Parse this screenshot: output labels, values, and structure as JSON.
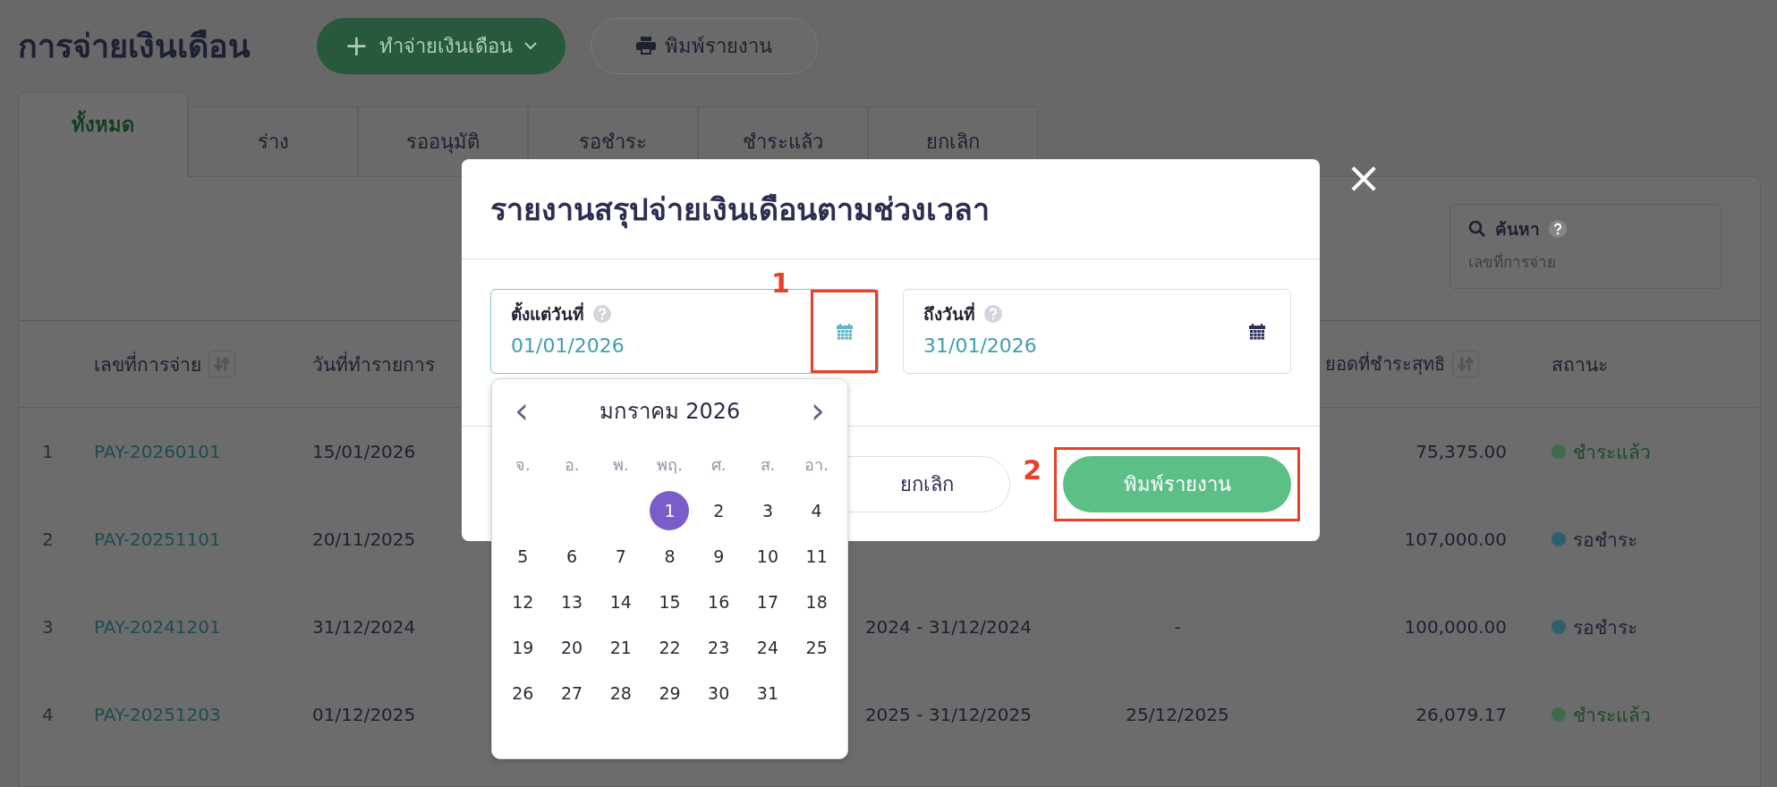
{
  "page": {
    "title": "การจ่ายเงินเดือน",
    "create_button": {
      "icon": "+",
      "label": "ทำจ่ายเงินเดือน"
    },
    "print_button": {
      "label": "พิมพ์รายงาน"
    }
  },
  "tabs": [
    {
      "label": "ทั้งหมด",
      "selected": true
    },
    {
      "label": "ร่าง",
      "selected": false
    },
    {
      "label": "รออนุมัติ",
      "selected": false
    },
    {
      "label": "รอชำระ",
      "selected": false
    },
    {
      "label": "ชำระแล้ว",
      "selected": false
    },
    {
      "label": "ยกเลิก",
      "selected": false
    }
  ],
  "search": {
    "label": "ค้นหา",
    "placeholder": "เลขที่การจ่าย"
  },
  "table": {
    "columns": [
      {
        "label": "เลขที่การจ่าย",
        "sortable": true
      },
      {
        "label": "วันที่ทำรายการ",
        "sortable": false
      },
      {
        "label": "ยอดที่ชำระสุทธิ",
        "sortable": true
      },
      {
        "label": "สถานะ",
        "sortable": false
      }
    ],
    "rows": [
      {
        "index": "1",
        "number": "PAY-20260101",
        "date": "15/01/2026",
        "amount": "75,375.00",
        "status": {
          "kind": "paid",
          "label": "ชำระแล้ว",
          "color": "#3e6b49"
        }
      },
      {
        "index": "2",
        "number": "PAY-20251101",
        "date": "20/11/2025",
        "amount": "107,000.00",
        "status": {
          "kind": "pending",
          "label": "รอชำระ",
          "color": "#2d606c"
        }
      },
      {
        "index": "3",
        "number": "PAY-20241201",
        "date": "31/12/2024",
        "period": "2024 - 31/12/2024",
        "paid_date": "-",
        "amount": "100,000.00",
        "status": {
          "kind": "pending",
          "label": "รอชำระ",
          "color": "#2d606c"
        }
      },
      {
        "index": "4",
        "number": "PAY-20251203",
        "date": "01/12/2025",
        "period": "2025 - 31/12/2025",
        "paid_date": "25/12/2025",
        "amount": "26,079.17",
        "status": {
          "kind": "paid",
          "label": "ชำระแล้ว",
          "color": "#3e6b49"
        }
      }
    ]
  },
  "modal": {
    "title": "รายงานสรุปจ่ายเงินเดือนตามช่วงเวลา",
    "close": "×",
    "fields": [
      {
        "label": "ตั้งแต่วันที่",
        "value": "01/01/2026",
        "focused": true,
        "highlight": "1"
      },
      {
        "label": "ถึงวันที่",
        "value": "31/01/2026",
        "focused": false
      }
    ],
    "cancel_button": "ยกเลิก",
    "print_button": {
      "label": "พิมพ์รายงาน",
      "highlight": "2"
    }
  },
  "calendar": {
    "month": "มกราคม 2026",
    "prev": "‹",
    "next": "›",
    "weekdays": [
      "จ.",
      "อ.",
      "พ.",
      "พฤ.",
      "ศ.",
      "ส.",
      "อา."
    ],
    "weeks": [
      [
        {
          "day": "1",
          "selected": true
        },
        {
          "day": "2",
          "selected": false
        },
        {
          "day": "3",
          "selected": false
        },
        {
          "day": "4",
          "selected": false
        }
      ],
      [
        {
          "day": "5",
          "selected": false
        },
        {
          "day": "6",
          "selected": false
        },
        {
          "day": "7",
          "selected": false
        },
        {
          "day": "8",
          "selected": false
        },
        {
          "day": "9",
          "selected": false
        },
        {
          "day": "10",
          "selected": false
        },
        {
          "day": "11",
          "selected": false
        }
      ],
      [
        {
          "day": "12",
          "selected": false
        },
        {
          "day": "13",
          "selected": false
        },
        {
          "day": "14",
          "selected": false
        },
        {
          "day": "15",
          "selected": false
        },
        {
          "day": "16",
          "selected": false
        },
        {
          "day": "17",
          "selected": false
        },
        {
          "day": "18",
          "selected": false
        }
      ],
      [
        {
          "day": "19",
          "selected": false
        },
        {
          "day": "20",
          "selected": false
        },
        {
          "day": "21",
          "selected": false
        },
        {
          "day": "22",
          "selected": false
        },
        {
          "day": "23",
          "selected": false
        },
        {
          "day": "24",
          "selected": false
        },
        {
          "day": "25",
          "selected": false
        }
      ],
      [
        {
          "day": "26",
          "selected": false
        },
        {
          "day": "27",
          "selected": false
        },
        {
          "day": "28",
          "selected": false
        },
        {
          "day": "29",
          "selected": false
        },
        {
          "day": "30",
          "selected": false
        },
        {
          "day": "31",
          "selected": false
        }
      ]
    ]
  }
}
